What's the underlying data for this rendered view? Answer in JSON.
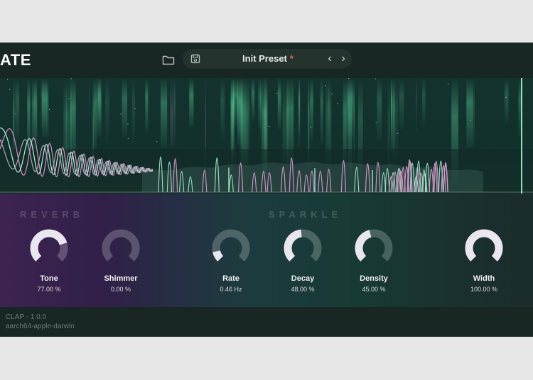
{
  "header": {
    "logo_text": "ATE",
    "folder_icon": "folder-icon",
    "save_icon": "save-icon",
    "preset_name": "Init Preset",
    "preset_dirty_marker": "*",
    "prev_symbol": "‹",
    "next_symbol": "›"
  },
  "sections": {
    "reverb_title": "REVERB",
    "sparkle_title": "SPARKLE"
  },
  "knobs": [
    {
      "label": "Tone",
      "value": "77.00 %",
      "level": 0.77
    },
    {
      "label": "Shimmer",
      "value": "0.00 %",
      "level": 0.0
    },
    {
      "label": "Rate",
      "value": "0.46 Hz",
      "level": 0.12
    },
    {
      "label": "Decay",
      "value": "48.00 %",
      "level": 0.48
    },
    {
      "label": "Density",
      "value": "45.00 %",
      "level": 0.45
    },
    {
      "label": "Width",
      "value": "100.00 %",
      "level": 1.0
    }
  ],
  "footer": {
    "format_version": "CLAP - 1.0.0",
    "platform": "aarch64-apple-darwin"
  },
  "colors": {
    "accent_pink": "#d98ac4",
    "accent_green": "#6fe3b1",
    "knob_fill": "#e9e6f0",
    "knob_track": "rgba(255,255,255,0.22)",
    "dirty_marker": "#e2645b"
  }
}
